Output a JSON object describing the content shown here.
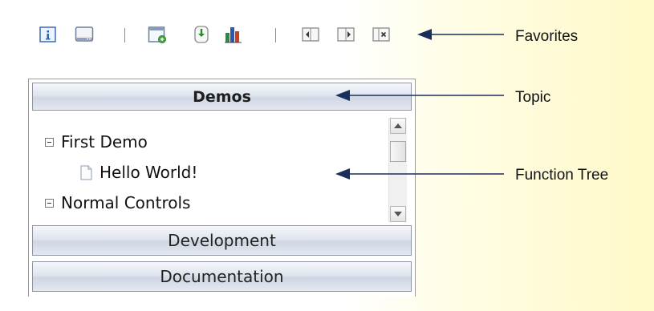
{
  "toolbar": {
    "icons": [
      {
        "name": "info-icon",
        "glyph": "i"
      },
      {
        "name": "window-icon"
      },
      {
        "name": "open-window-icon"
      },
      {
        "name": "download-icon"
      },
      {
        "name": "bar-chart-icon"
      },
      {
        "name": "navigate-back-icon"
      },
      {
        "name": "navigate-forward-icon"
      },
      {
        "name": "close-page-icon"
      }
    ]
  },
  "topic": {
    "title": "Demos"
  },
  "tree": {
    "items": [
      {
        "label": "First Demo",
        "type": "folder",
        "expanded": true
      },
      {
        "label": "Hello World!",
        "type": "document"
      },
      {
        "label": "Normal Controls",
        "type": "folder",
        "expanded": true
      }
    ]
  },
  "topics": [
    {
      "label": "Development"
    },
    {
      "label": "Documentation"
    }
  ],
  "callouts": {
    "favorites": "Favorites",
    "topic": "Topic",
    "function_tree": "Function Tree"
  },
  "colors": {
    "arrow": "#1a2e5c",
    "header_gradient_top": "#f5f7fb",
    "header_gradient_bottom": "#cfd6e3",
    "background_yellow": "#fff9c8"
  }
}
